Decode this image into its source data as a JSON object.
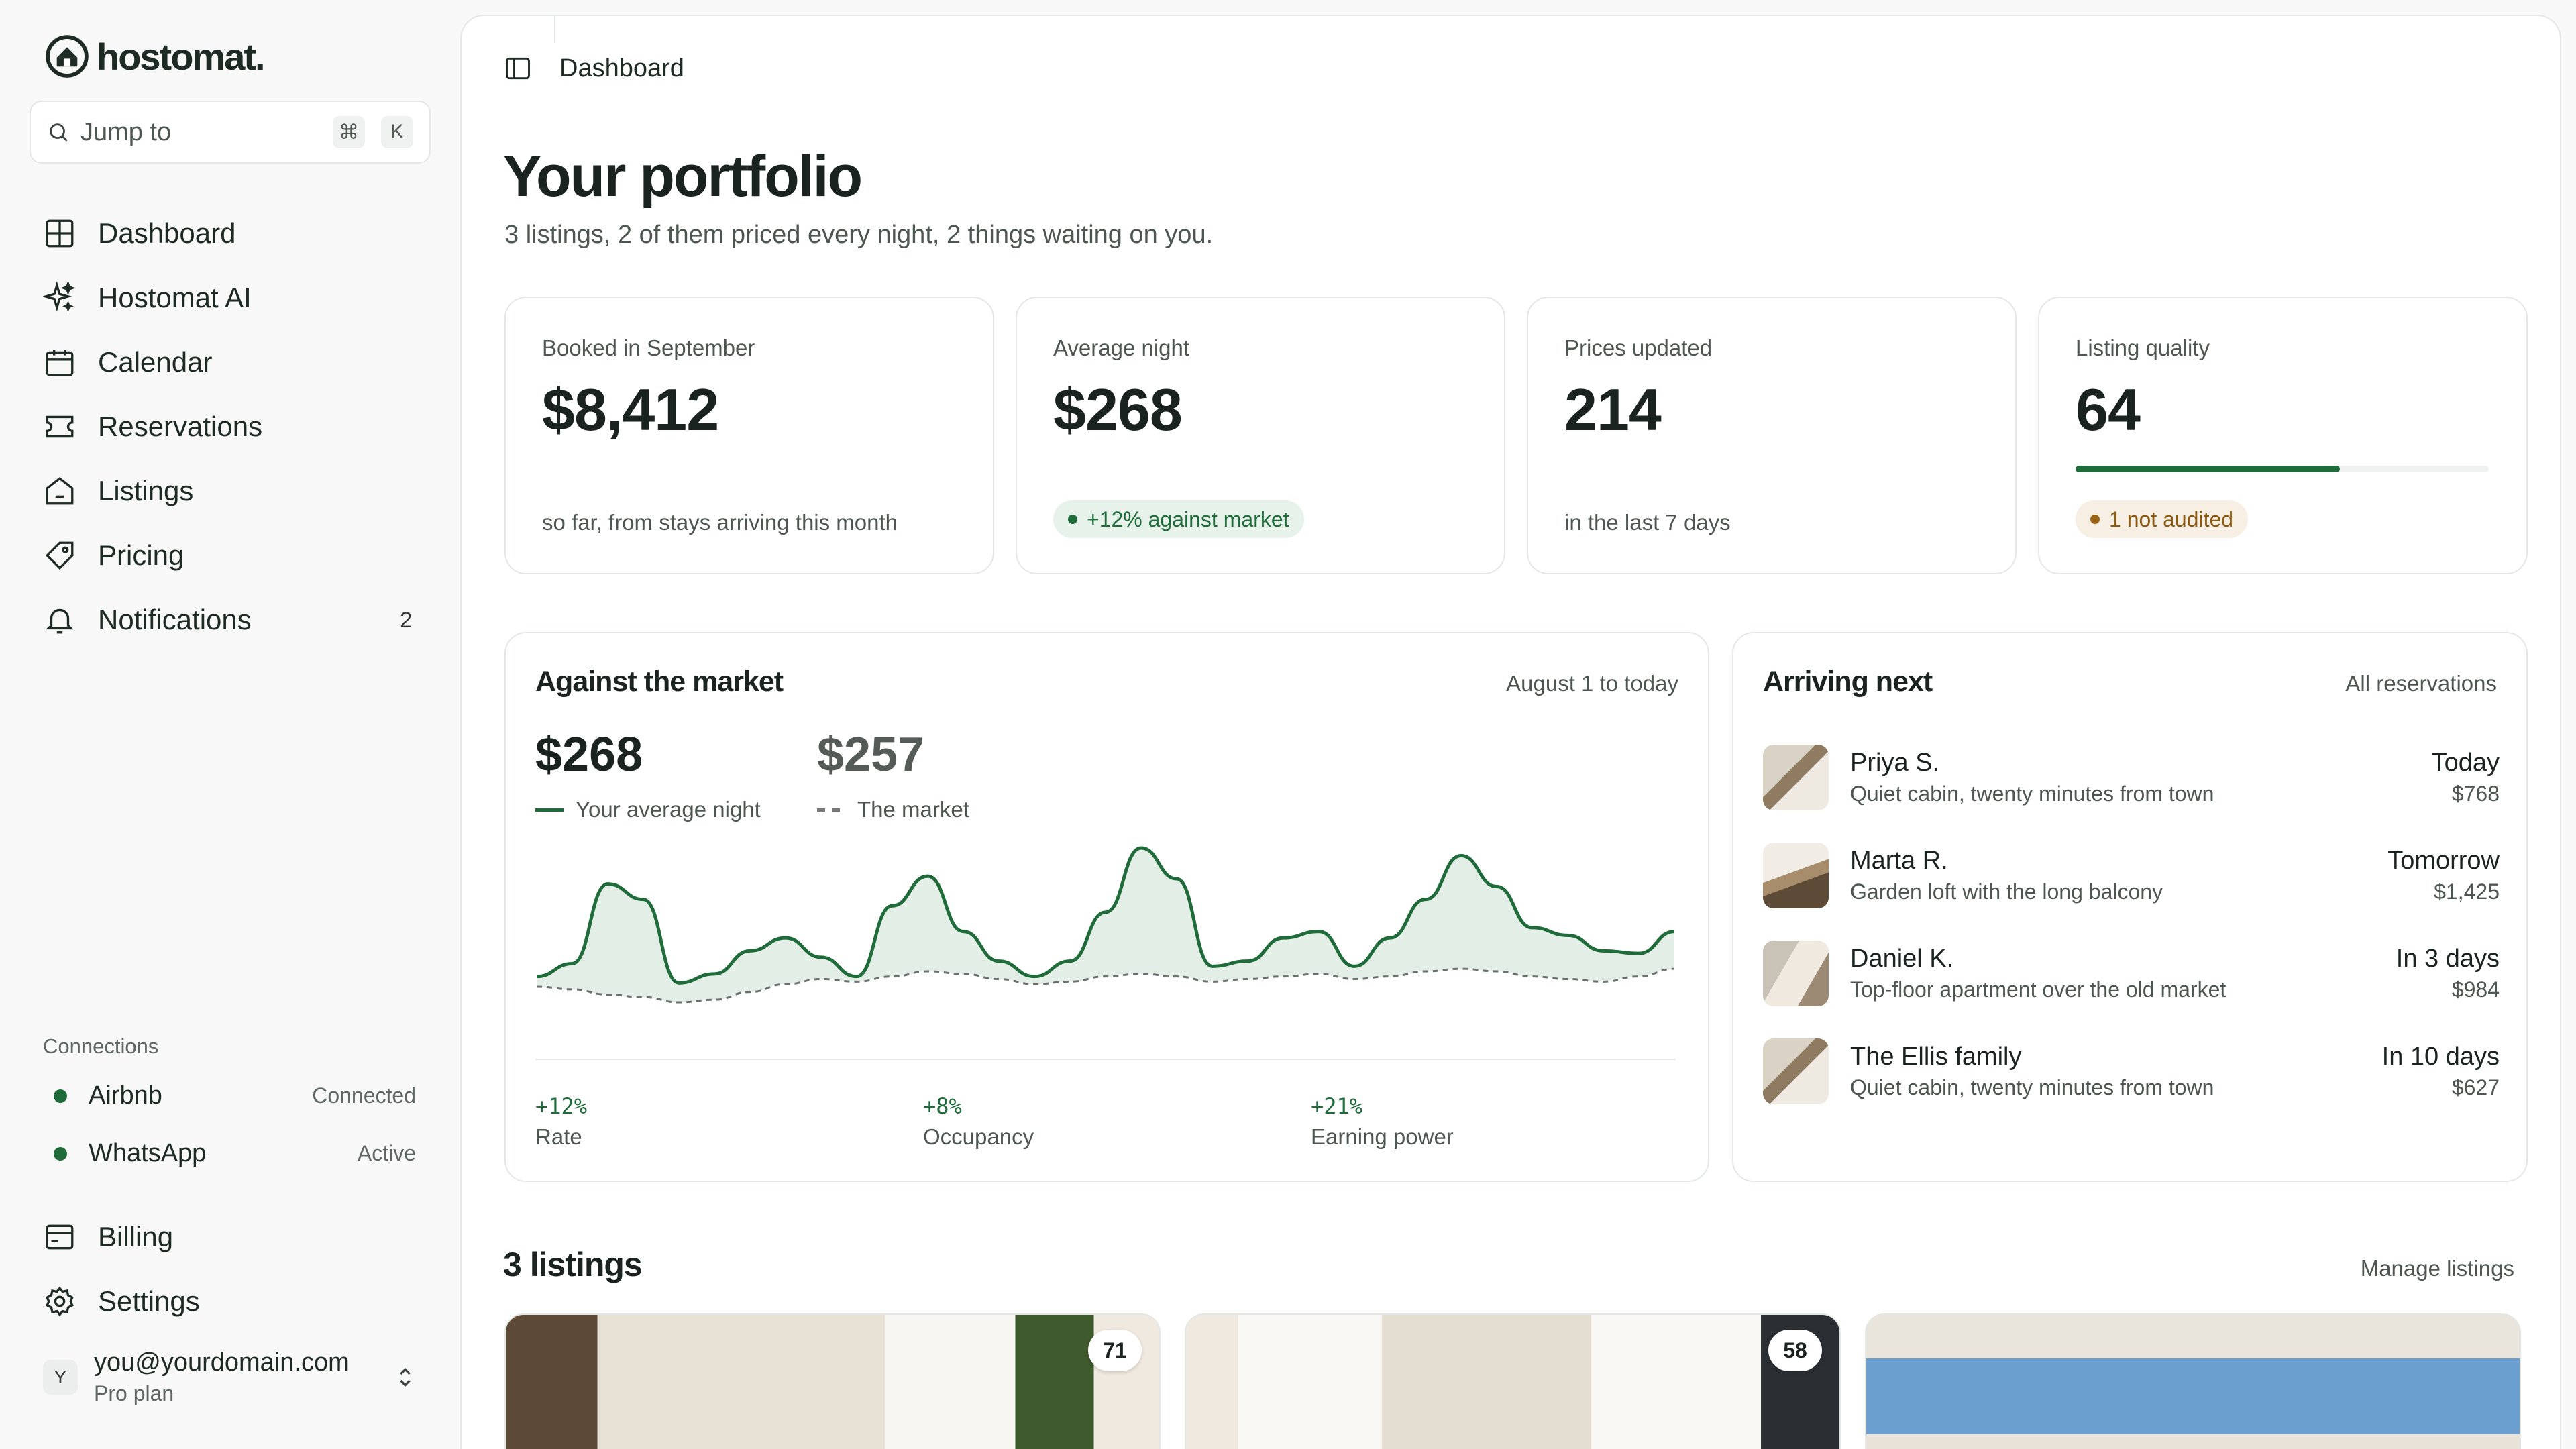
{
  "brand": {
    "name": "hostomat."
  },
  "search": {
    "label": "Jump to",
    "key1": "⌘",
    "key2": "K"
  },
  "nav": {
    "items": [
      {
        "label": "Dashboard"
      },
      {
        "label": "Hostomat AI"
      },
      {
        "label": "Calendar"
      },
      {
        "label": "Reservations"
      },
      {
        "label": "Listings"
      },
      {
        "label": "Pricing"
      },
      {
        "label": "Notifications",
        "count": "2"
      }
    ]
  },
  "connections": {
    "title": "Connections",
    "items": [
      {
        "name": "Airbnb",
        "status": "Connected"
      },
      {
        "name": "WhatsApp",
        "status": "Active"
      }
    ]
  },
  "nav_bottom": {
    "billing": "Billing",
    "settings": "Settings"
  },
  "account": {
    "initial": "Y",
    "email": "you@yourdomain.com",
    "plan": "Pro plan"
  },
  "header": {
    "breadcrumb": "Dashboard"
  },
  "page": {
    "title": "Your portfolio",
    "subtitle": "3 listings, 2 of them priced every night, 2 things waiting on you."
  },
  "stats": [
    {
      "label": "Booked in September",
      "value": "$8,412",
      "foot": "so far, from stays arriving this month"
    },
    {
      "label": "Average night",
      "value": "$268",
      "pill": "+12% against market"
    },
    {
      "label": "Prices updated",
      "value": "214",
      "foot": "in the last 7 days"
    },
    {
      "label": "Listing quality",
      "value": "64",
      "progress": 0.64,
      "pill": "1 not audited"
    }
  ],
  "market": {
    "title": "Against the market",
    "range": "August 1 to today",
    "yours": {
      "value": "$268",
      "label": "Your average night"
    },
    "market": {
      "value": "$257",
      "label": "The market"
    },
    "deltas": [
      {
        "value": "+12%",
        "label": "Rate"
      },
      {
        "value": "+8%",
        "label": "Occupancy"
      },
      {
        "value": "+21%",
        "label": "Earning power"
      }
    ]
  },
  "chart_data": {
    "type": "area",
    "title": "Against the market",
    "series": [
      {
        "name": "Your average night",
        "values": [
          10,
          20,
          82,
          70,
          5,
          12,
          30,
          40,
          25,
          10,
          65,
          88,
          45,
          22,
          10,
          22,
          60,
          110,
          86,
          18,
          22,
          40,
          45,
          18,
          40,
          70,
          104,
          80,
          48,
          42,
          30,
          28,
          45
        ]
      },
      {
        "name": "The market",
        "values": [
          2,
          0,
          -4,
          -6,
          -10,
          -8,
          -2,
          4,
          8,
          6,
          10,
          14,
          12,
          8,
          4,
          6,
          10,
          12,
          10,
          6,
          8,
          10,
          12,
          8,
          10,
          14,
          16,
          14,
          10,
          8,
          6,
          10,
          16
        ]
      }
    ]
  },
  "arrivals": {
    "title": "Arriving next",
    "link": "All reservations",
    "items": [
      {
        "name": "Priya S.",
        "desc": "Quiet cabin, twenty minutes from town",
        "when": "Today",
        "price": "$768"
      },
      {
        "name": "Marta R.",
        "desc": "Garden loft with the long balcony",
        "when": "Tomorrow",
        "price": "$1,425"
      },
      {
        "name": "Daniel K.",
        "desc": "Top-floor apartment over the old market",
        "when": "In 3 days",
        "price": "$984"
      },
      {
        "name": "The Ellis family",
        "desc": "Quiet cabin, twenty minutes from town",
        "when": "In 10 days",
        "price": "$627"
      }
    ]
  },
  "listings": {
    "title": "3 listings",
    "link": "Manage listings",
    "scores": [
      "71",
      "58"
    ]
  },
  "colors": {
    "accent": "#1f6b3a",
    "warning": "#9a6214"
  }
}
